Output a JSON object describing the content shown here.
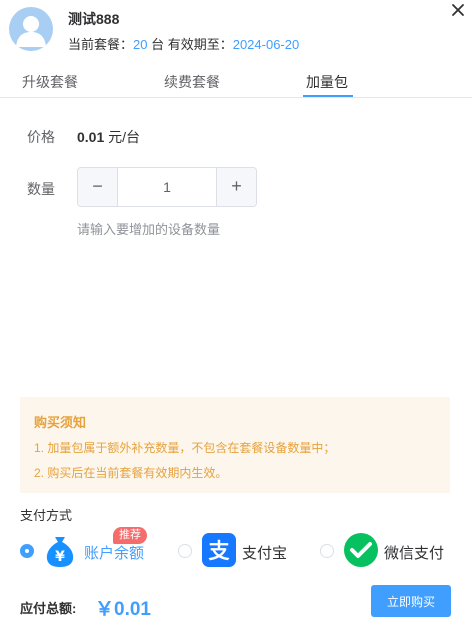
{
  "header": {
    "user_name": "测试888",
    "plan_prefix": "当前套餐：",
    "plan_count": "20",
    "plan_unit": " 台 有效期至：",
    "expiry_date": "2024-06-20",
    "avatar_icon": "user-avatar-icon",
    "close_icon": "close-icon"
  },
  "tabs": [
    {
      "label": "升级套餐",
      "active": false
    },
    {
      "label": "续费套餐",
      "active": false
    },
    {
      "label": "加量包",
      "active": true
    }
  ],
  "form": {
    "price_label": "价格",
    "price_amount": "0.01",
    "price_unit": " 元/台",
    "quantity_label": "数量",
    "quantity_value": "1",
    "minus_symbol": "−",
    "plus_symbol": "+",
    "quantity_hint": "请输入要增加的设备数量"
  },
  "notice": {
    "title": "购买须知",
    "items": [
      "1. 加量包属于额外补充数量，不包含在套餐设备数量中；",
      "2. 购买后在当前套餐有效期内生效。"
    ]
  },
  "payment": {
    "label": "支付方式",
    "badge": "推荐",
    "options": [
      {
        "label": "账户余额",
        "icon": "money-bag-icon",
        "selected": true
      },
      {
        "label": "支付宝",
        "icon": "alipay-icon",
        "selected": false
      },
      {
        "label": "微信支付",
        "icon": "wechat-pay-icon",
        "selected": false
      }
    ]
  },
  "footer": {
    "total_label": "应付总额:",
    "total_value": "￥0.01",
    "buy_label": "立即购买"
  },
  "colors": {
    "accent": "#409eff",
    "warning": "#e6a23c",
    "notice_bg": "#fdf6ec",
    "badge": "#f56c6c",
    "alipay": "#1677ff",
    "wechat": "#07c160"
  }
}
